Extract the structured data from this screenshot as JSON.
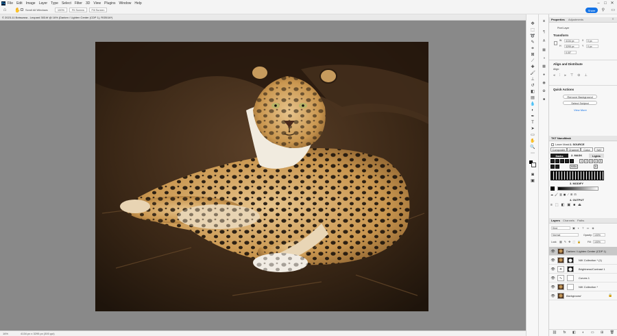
{
  "menubar": {
    "app_logo": "Ps",
    "items": [
      "File",
      "Edit",
      "Image",
      "Layer",
      "Type",
      "Select",
      "Filter",
      "3D",
      "View",
      "Plugins",
      "Window",
      "Help"
    ]
  },
  "options_bar": {
    "scroll_all_windows": "Scroll All Windows",
    "zoom": "100%",
    "fit_screen": "Fit Screen",
    "fill_screen": "Fill Screen",
    "share": "Share"
  },
  "document": {
    "tab_title": "© 2023-11 Botswana - Leopard 303.tif @ 16% (Darken / Lighten Center (CDP 1), RGB/16*)"
  },
  "status_bar": {
    "zoom": "16%",
    "dimensions": "4134 px x 3295 px (300 ppi)"
  },
  "tools": [
    "move-icon",
    "marquee-icon",
    "lasso-icon",
    "quick-select-icon",
    "crop-icon",
    "frame-icon",
    "eyedropper-icon",
    "healing-icon",
    "brush-icon",
    "stamp-icon",
    "history-brush-icon",
    "eraser-icon",
    "gradient-icon",
    "blur-icon",
    "dodge-icon",
    "pen-icon",
    "type-icon",
    "path-select-icon",
    "shape-icon",
    "hand-icon",
    "zoom-icon",
    "more-icon"
  ],
  "properties": {
    "tabs": [
      "Properties",
      "Adjustments"
    ],
    "layer_type": "Pixel Layer",
    "transform_heading": "Transform",
    "w": "4134 px",
    "h": "3295 px",
    "x": "0 px",
    "y": "0 px",
    "angle": "0.00°",
    "align_heading": "Align and Distribute",
    "align_label": "Align:",
    "quick_actions_heading": "Quick Actions",
    "remove_background": "Remove Background",
    "select_subject": "Select Subject",
    "view_more": "View More"
  },
  "nanomask": {
    "title": "TKT NanoMask",
    "laser_mask": "Laser Mask",
    "section1": "1. SOURCE",
    "composite": "Composite",
    "channel": "Channel",
    "color": "Color",
    "sat": "SAT",
    "section2": "2. MASK",
    "darks": "Darks",
    "lights": "Lights",
    "value_numbers": [
      "1",
      "2",
      "3",
      "4",
      "5",
      "6"
    ],
    "mids": "MIDs",
    "section3": "3. MODIFY",
    "section4": "4. OUTPUT"
  },
  "layers_panel": {
    "tabs": [
      "Layers",
      "Channels",
      "Paths"
    ],
    "kind": "Kind",
    "blend_mode": "Normal",
    "opacity_label": "Opacity:",
    "opacity": "100%",
    "lock_label": "Lock:",
    "fill_label": "Fill:",
    "fill": "100%",
    "layers": [
      {
        "name": "Darken / Lighten Center (CDP 1)",
        "selected": true
      },
      {
        "name": "NIK Collection * (1)",
        "selected": false
      },
      {
        "name": "Brightness/Contrast 1",
        "selected": false
      },
      {
        "name": "Curves 1",
        "selected": false
      },
      {
        "name": "NIK Collection *",
        "selected": false
      },
      {
        "name": "Background",
        "selected": false
      }
    ]
  },
  "colors": {
    "accent": "#1473e6",
    "canvas_bg": "#898989",
    "selected_layer": "#c8c8c8"
  }
}
